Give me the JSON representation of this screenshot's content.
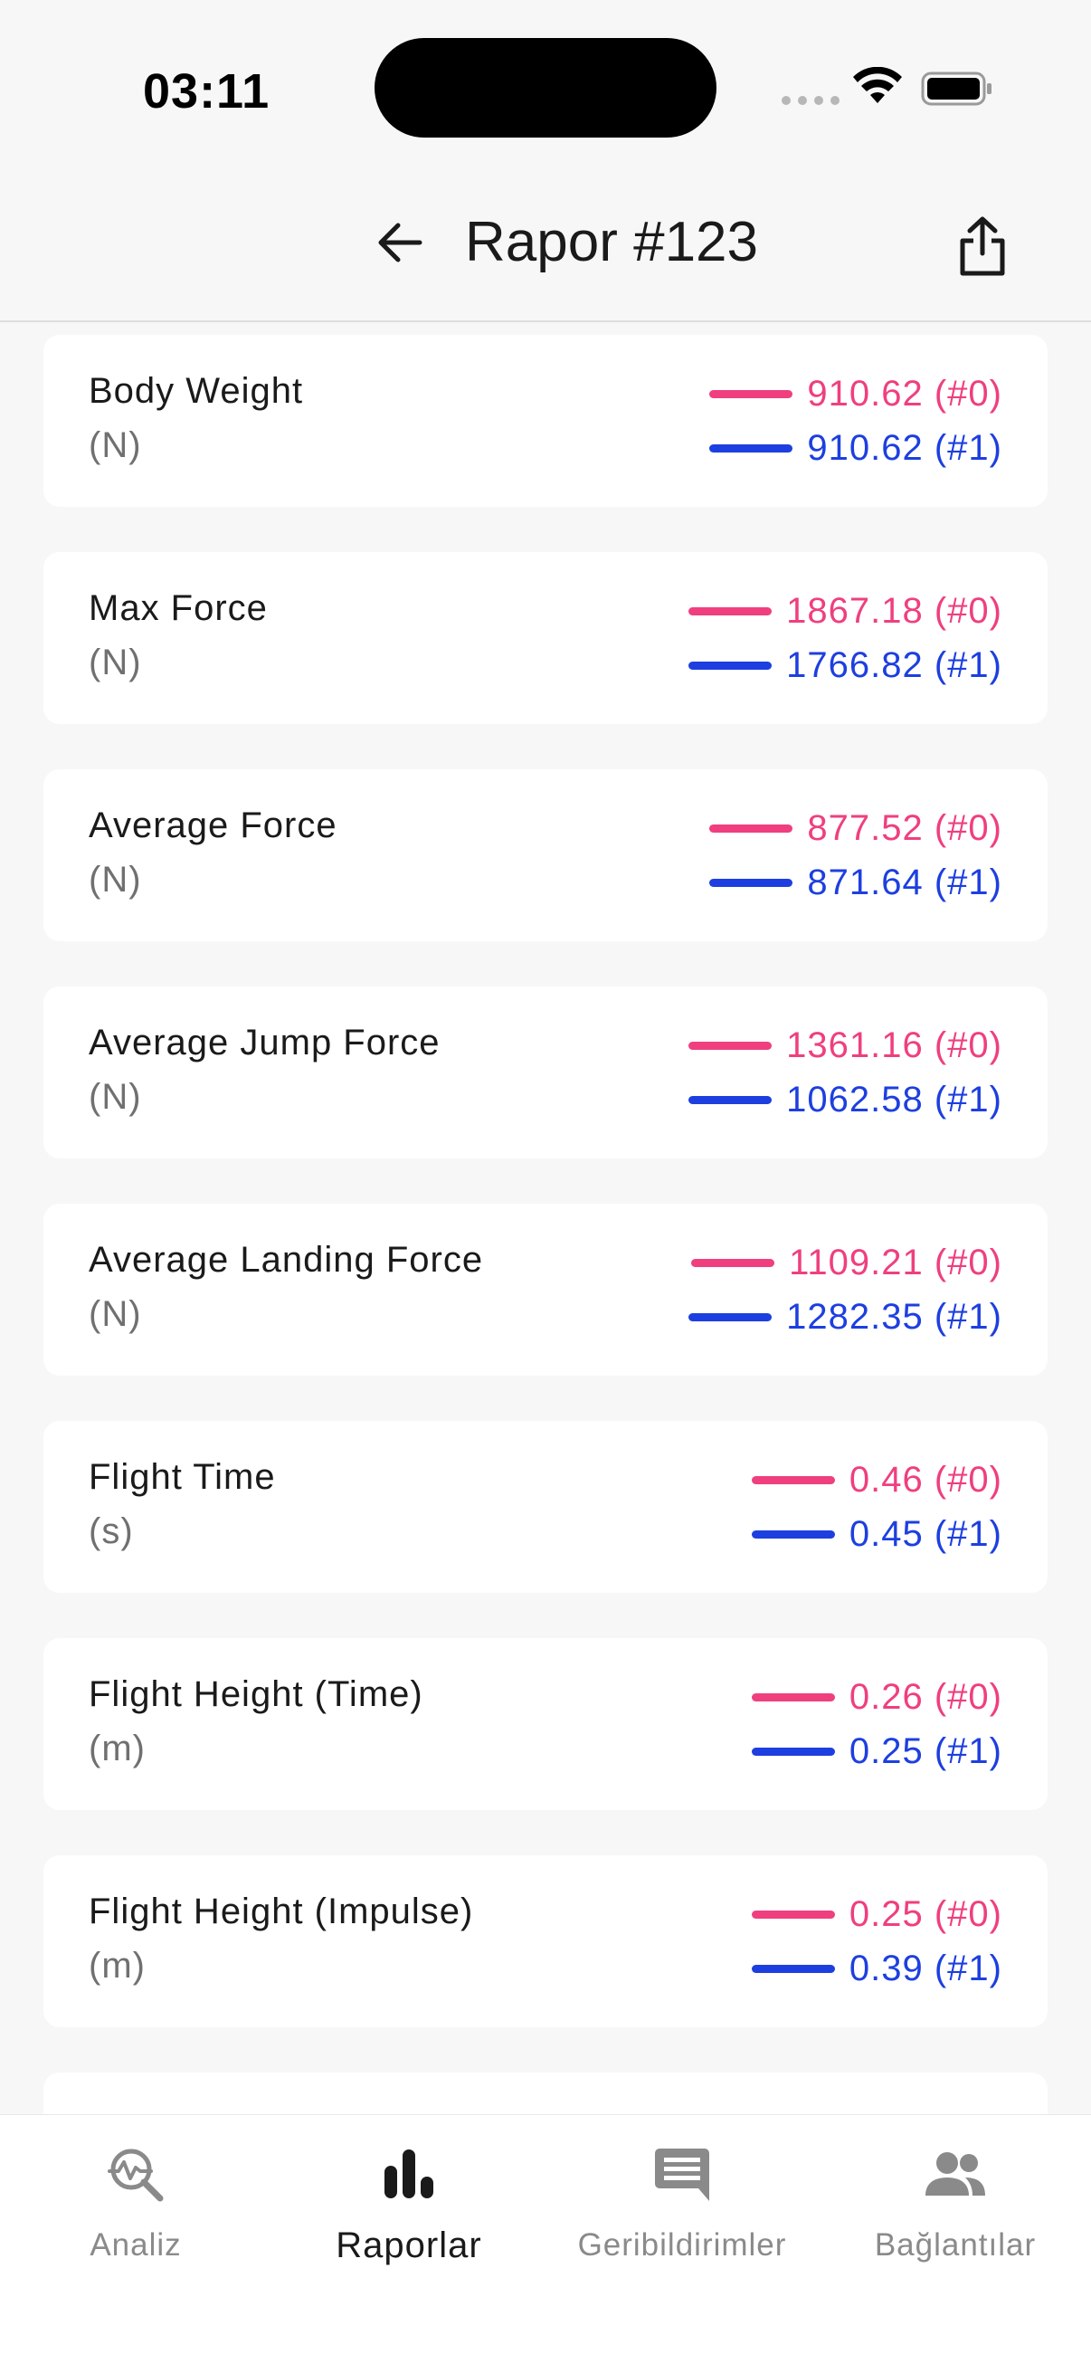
{
  "status": {
    "time": "03:11"
  },
  "header": {
    "title": "Rapor #123"
  },
  "colors": {
    "series0": "#ef3f7f",
    "series1": "#1d3fe0"
  },
  "metrics": [
    {
      "title": "Body Weight",
      "unit": "(N)",
      "v0": "910.62 (#0)",
      "v1": "910.62 (#1)"
    },
    {
      "title": "Max Force",
      "unit": "(N)",
      "v0": "1867.18 (#0)",
      "v1": "1766.82 (#1)"
    },
    {
      "title": "Average Force",
      "unit": "(N)",
      "v0": "877.52 (#0)",
      "v1": "871.64 (#1)"
    },
    {
      "title": "Average Jump Force",
      "unit": "(N)",
      "v0": "1361.16 (#0)",
      "v1": "1062.58 (#1)"
    },
    {
      "title": "Average Landing Force",
      "unit": "(N)",
      "v0": "1109.21 (#0)",
      "v1": "1282.35 (#1)"
    },
    {
      "title": "Flight Time",
      "unit": "(s)",
      "v0": "0.46 (#0)",
      "v1": "0.45 (#1)"
    },
    {
      "title": "Flight Height (Time)",
      "unit": "(m)",
      "v0": "0.26 (#0)",
      "v1": "0.25 (#1)"
    },
    {
      "title": "Flight Height (Impulse)",
      "unit": "(m)",
      "v0": "0.25 (#0)",
      "v1": "0.39 (#1)"
    }
  ],
  "nav": {
    "items": [
      {
        "label": "Analiz",
        "icon": "analysis-icon",
        "active": false
      },
      {
        "label": "Raporlar",
        "icon": "bar-chart-icon",
        "active": true
      },
      {
        "label": "Geribildirimler",
        "icon": "message-icon",
        "active": false
      },
      {
        "label": "Bağlantılar",
        "icon": "people-icon",
        "active": false
      }
    ]
  }
}
